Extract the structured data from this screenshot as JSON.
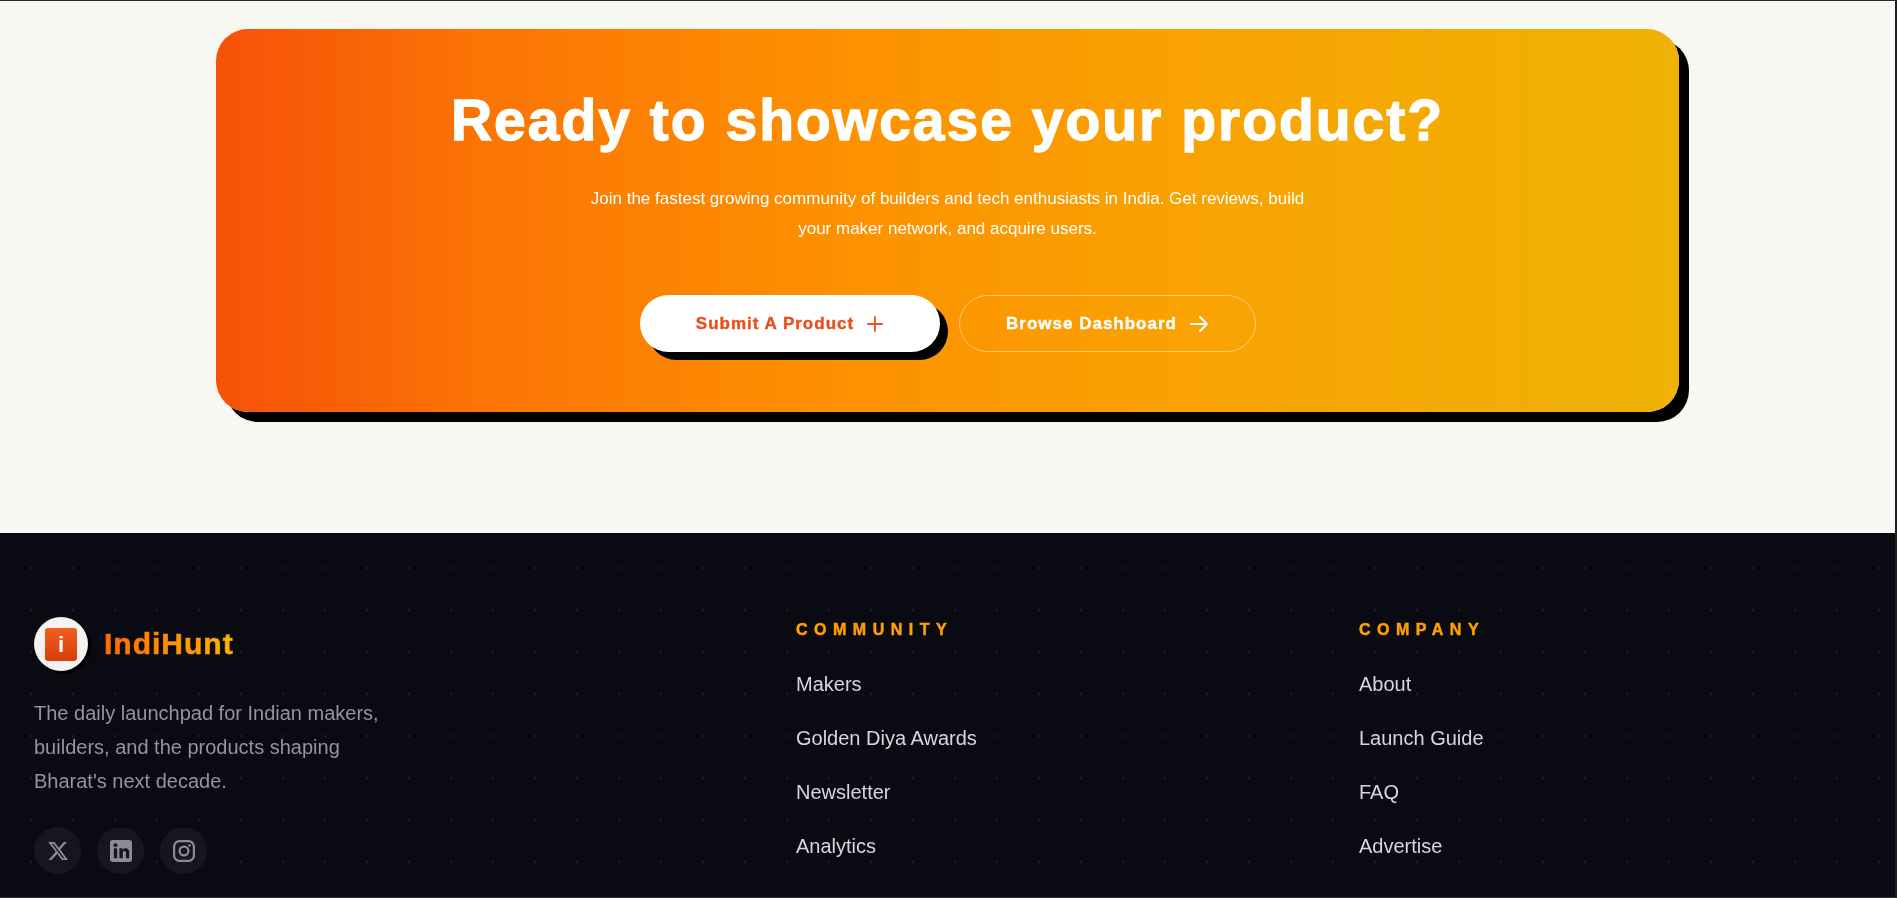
{
  "cta": {
    "heading": "Ready to showcase your product?",
    "description": "Join the fastest growing community of builders and tech enthusiasts in India. Get reviews, build your maker network, and acquire users.",
    "buttons": [
      {
        "label": "Submit A Product",
        "kind": "primary"
      },
      {
        "label": "Browse Dashboard",
        "kind": "outline"
      }
    ]
  },
  "footer": {
    "brand": {
      "mark": "i",
      "name": "IndiHunt"
    },
    "tagline": "The daily launchpad for Indian makers, builders, and the products shaping Bharat's next decade.",
    "social_links": [
      {
        "kind": "x"
      },
      {
        "kind": "linkedin"
      },
      {
        "kind": "instagram"
      }
    ],
    "columns": [
      {
        "heading": "COMMUNITY",
        "links": [
          "Makers",
          "Golden Diya Awards",
          "Newsletter",
          "Analytics"
        ]
      },
      {
        "heading": "COMPANY",
        "links": [
          "About",
          "Launch Guide",
          "FAQ",
          "Advertise"
        ]
      }
    ]
  }
}
